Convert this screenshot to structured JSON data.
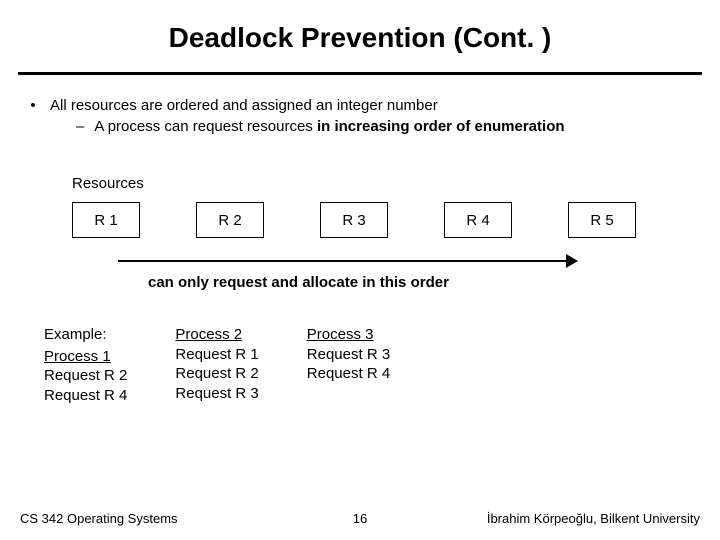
{
  "title": "Deadlock Prevention (Cont. )",
  "bullet1": "All resources are ordered and assigned an integer number",
  "bullet2_prefix": "A process can request resources ",
  "bullet2_strong": "in increasing order of enumeration",
  "resources_label": "Resources",
  "boxes": {
    "r1": "R 1",
    "r2": "R 2",
    "r3": "R 3",
    "r4": "R 4",
    "r5": "R 5"
  },
  "arrow_caption": "can only request and allocate in this order",
  "example_label": "Example:",
  "processes": [
    {
      "name": "Process 1",
      "reqs": [
        "Request R 2",
        "Request R 4"
      ]
    },
    {
      "name": "Process 2",
      "reqs": [
        "Request R 1",
        "Request R 2",
        "Request R 3"
      ]
    },
    {
      "name": "Process 3",
      "reqs": [
        "Request R 3",
        "Request R 4"
      ]
    }
  ],
  "footer": {
    "left": "CS 342 Operating Systems",
    "page": "16",
    "right": "İbrahim Körpeoğlu, Bilkent University"
  }
}
